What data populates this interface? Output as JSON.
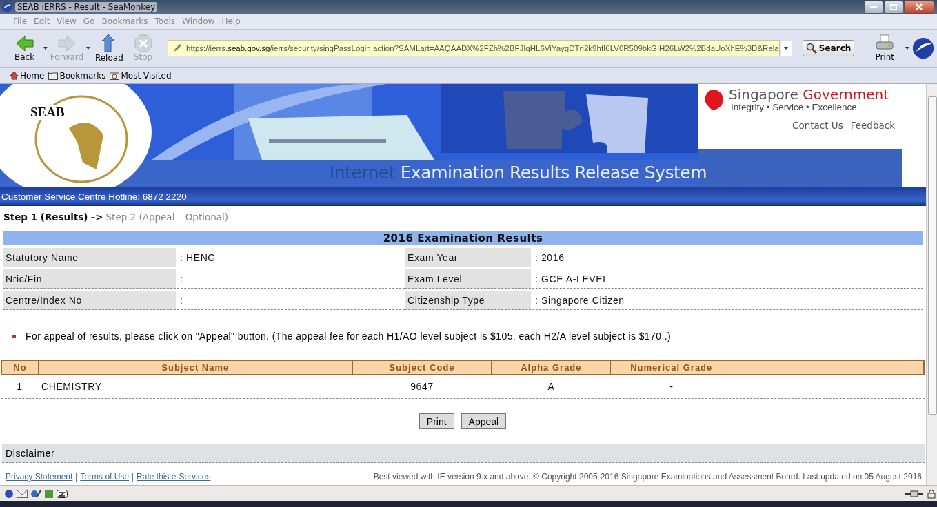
{
  "window": {
    "title": "SEAB iERRS - Result - SeaMonkey"
  },
  "menu": [
    "File",
    "Edit",
    "View",
    "Go",
    "Bookmarks",
    "Tools",
    "Window",
    "Help"
  ],
  "toolbar": [
    {
      "kind": "back",
      "label": "Back",
      "disabled": false
    },
    {
      "kind": "forward",
      "label": "Forward",
      "disabled": true
    },
    {
      "kind": "reload",
      "label": "Reload",
      "disabled": false
    },
    {
      "kind": "stop",
      "label": "Stop",
      "disabled": true
    }
  ],
  "address": {
    "prefix": "https://ierrs.",
    "host": "seab.gov.sg",
    "path": "/ierrs/security/singPassLogin.action?SAMLart=AAQAADX%2FZh%2BFJIqHL6ViYaygDTn2k9hfI6LV0R509bkGIH26LW2%2BdaUoXhE%3D&Rela"
  },
  "search_button": "Search",
  "print_button": "Print",
  "bookmarks": [
    {
      "kind": "home",
      "label": "Home"
    },
    {
      "kind": "folder",
      "label": "Bookmarks"
    },
    {
      "kind": "visited",
      "label": "Most Visited"
    }
  ],
  "banner": {
    "logo_text": "SEAB",
    "title_a": "Internet",
    "title_b": " Examination Results Release System",
    "gov_a": "Singapore",
    "gov_b": " Government",
    "motto": "Integrity • Service • Excellence",
    "links": [
      "Contact Us",
      "Feedback"
    ]
  },
  "hotline": "Customer Service Centre Hotline: 6872 2220",
  "steps": [
    {
      "label": "Step 1 (Results)",
      "selected": true
    },
    {
      "label": "Step 2 (Appeal – Optional)",
      "selected": false
    }
  ],
  "step_arrow": "–>",
  "results_title": "2016 Examination Results",
  "info": [
    {
      "label": "Statutory Name",
      "value": ": HENG",
      "label2": "Exam Year",
      "value2": ": 2016"
    },
    {
      "label": "Nric/Fin",
      "value": ":",
      "label2": "Exam Level",
      "value2": ": GCE A-LEVEL"
    },
    {
      "label": "Centre/Index No",
      "value": ":",
      "label2": "Citizenship Type",
      "value2": ": Singapore Citizen"
    }
  ],
  "note": "For appeal of results, please click on \"Appeal\" button. (The appeal fee for each H1/AO level subject is $105, each H2/A level subject is $170 .)",
  "table": {
    "columns": [
      "No",
      "Subject Name",
      "Subject Code",
      "Alpha Grade",
      "Numerical Grade"
    ],
    "rows": [
      [
        "1",
        "CHEMISTRY",
        "9647",
        "A",
        "-"
      ]
    ]
  },
  "buttons": [
    "Print",
    "Appeal"
  ],
  "disclaimer": "Disclaimer",
  "footer_links": [
    "Privacy Statement",
    "Terms of Use",
    "Rate this e-Services"
  ],
  "footer_text": "Best viewed with IE version 9.x and above. © Copyright 2005-2016 Singapore Examinations and Assessment Board. Last updated on 05 August 2016"
}
